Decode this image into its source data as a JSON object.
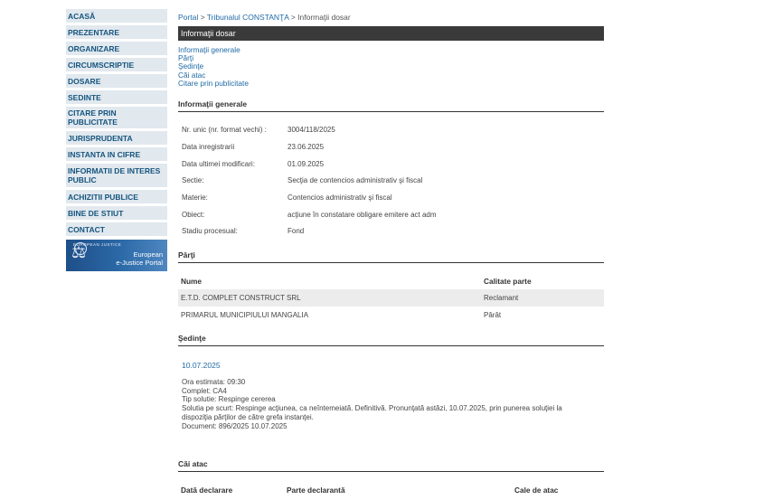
{
  "sidebar": {
    "items": [
      {
        "label": "ACASĂ"
      },
      {
        "label": "PREZENTARE"
      },
      {
        "label": "ORGANIZARE"
      },
      {
        "label": "CIRCUMSCRIPTIE"
      },
      {
        "label": "DOSARE"
      },
      {
        "label": "SEDINTE"
      },
      {
        "label": "CITARE PRIN PUBLICITATE"
      },
      {
        "label": "JURISPRUDENTA"
      },
      {
        "label": "INSTANTA IN CIFRE"
      },
      {
        "label": "INFORMATII DE INTERES PUBLIC"
      },
      {
        "label": "ACHIZITII PUBLICE"
      },
      {
        "label": "BINE DE STIUT"
      },
      {
        "label": "CONTACT"
      }
    ],
    "banner": {
      "small": "EUROPEAN JUSTICE",
      "line1": "European",
      "line2": "e-Justice Portal"
    }
  },
  "breadcrumb": {
    "home": "Portal",
    "sep1": " > ",
    "court": "Tribunalul CONSTANŢA",
    "sep2": " > ",
    "current": "Informaţii dosar"
  },
  "page_title": "Informaţii dosar",
  "anchors": [
    "Informaţii generale",
    "Părţi",
    "Şedinţe",
    "Căi atac",
    "Citare prin publicitate"
  ],
  "general": {
    "heading": "Informaţii generale",
    "rows": [
      {
        "label": "Nr. unic (nr. format vechi) :",
        "value": "3004/118/2025"
      },
      {
        "label": "Data inregistrarii",
        "value": "23.06.2025"
      },
      {
        "label": "Data ultimei modificari:",
        "value": "01.09.2025"
      },
      {
        "label": "Sectie:",
        "value": "Secţia de contencios administrativ şi fiscal"
      },
      {
        "label": "Materie:",
        "value": "Contencios administrativ şi fiscal"
      },
      {
        "label": "Obiect:",
        "value": "acţiune în constatare obligare emitere act adm"
      },
      {
        "label": "Stadiu procesual:",
        "value": "Fond"
      }
    ]
  },
  "parti": {
    "heading": "Părţi",
    "col_nume": "Nume",
    "col_calitate": "Calitate parte",
    "rows": [
      {
        "nume": "E.T.D. COMPLET CONSTRUCT SRL",
        "calitate": "Reclamant"
      },
      {
        "nume": "PRIMARUL MUNICIPIULUI MANGALIA",
        "calitate": "Pârât"
      }
    ]
  },
  "sedinte": {
    "heading": "Şedinţe",
    "date": "10.07.2025",
    "ora": "Ora estimata: 09:30",
    "complet": "Complet: CA4",
    "tip": "Tip solutie: Respinge cererea",
    "solutie1": "Solutia pe scurt: Respinge acţiunea, ca neîntemeiată. Definitivă. Pronunţată astăzi, 10.07.2025, prin punerea soluţiei la",
    "solutie2": "dispoziţia părţilor de către grefa instanţei.",
    "document": "Document:   896/2025  10.07.2025"
  },
  "cai_atac": {
    "heading": "Căi atac",
    "col_data": "Dată declarare",
    "col_parte": "Parte declarantă",
    "col_cale": "Cale de atac"
  }
}
